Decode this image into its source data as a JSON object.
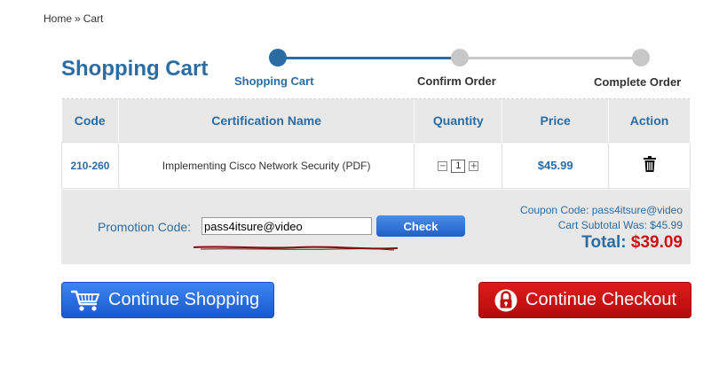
{
  "breadcrumb": {
    "home": "Home",
    "separator": "»",
    "current": "Cart"
  },
  "page_title": "Shopping Cart",
  "steps": [
    {
      "label": "Shopping Cart",
      "state": "active"
    },
    {
      "label": "Confirm Order",
      "state": "pending"
    },
    {
      "label": "Complete Order",
      "state": "pending"
    }
  ],
  "table": {
    "headers": [
      "Code",
      "Certification Name",
      "Quantity",
      "Price",
      "Action"
    ],
    "rows": [
      {
        "code": "210-260",
        "name": "Implementing Cisco Network Security (PDF)",
        "quantity": "1",
        "price": "$45.99",
        "action_icon": "trash-icon"
      }
    ]
  },
  "quantity_controls": {
    "decrement": "−",
    "increment": "+"
  },
  "promo": {
    "label": "Promotion Code:",
    "value": "pass4itsure@video",
    "button": "Check"
  },
  "summary": {
    "coupon": "Coupon Code: pass4itsure@video",
    "subtotal": "Cart Subtotal Was: $45.99",
    "total_label": "Total:",
    "total_amount": "$39.09"
  },
  "buttons": {
    "continue_shopping": "Continue Shopping",
    "continue_checkout": "Continue Checkout"
  },
  "colors": {
    "accent_blue": "#2b6ca3",
    "button_blue": "#1f5fc8",
    "button_red": "#c01010",
    "total_red": "#cc1111",
    "band_gray": "#e8e8e8"
  }
}
